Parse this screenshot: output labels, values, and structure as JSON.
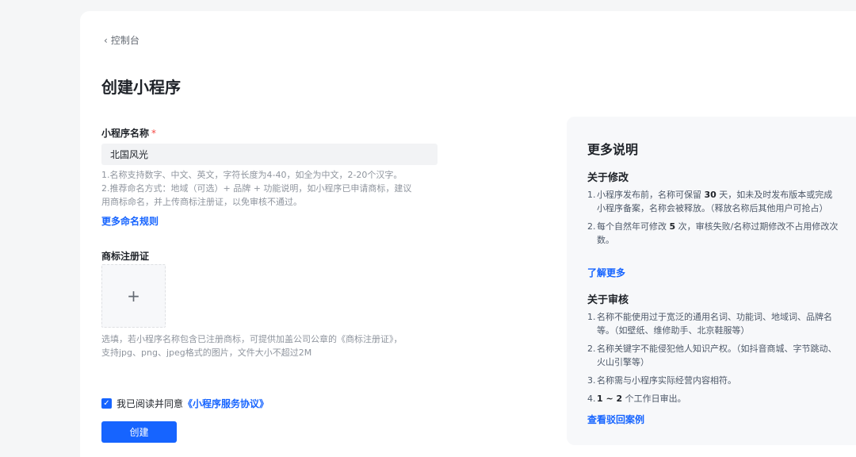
{
  "nav": {
    "back_label": "控制台"
  },
  "page": {
    "title": "创建小程序"
  },
  "form": {
    "name_label": "小程序名称",
    "required_mark": "*",
    "name_value": "北国风光",
    "name_hint_1": "1.名称支持数字、中文、英文，字符长度为4-40，如全为中文，2-20个汉字。",
    "name_hint_2a": "2.推荐命名方式：地域（可选）+ 品牌 + 功能说明，如小程序已申请商标，建议",
    "name_hint_2b": "用商标命名，并上传商标注册证，以免审核不通过。",
    "more_rules_link": "更多命名规则",
    "trademark_label": "商标注册证",
    "upload_plus": "+",
    "trademark_hint_1": "选填，若小程序名称包含已注册商标，可提供加盖公司公章的《商标注册证》，",
    "trademark_hint_2": "支持jpg、png、jpeg格式的图片，文件大小不超过2M",
    "agree_text": "我已阅读并同意",
    "agree_link": "《小程序服务协议》",
    "agree_checked": true,
    "create_button": "创建"
  },
  "sidebar": {
    "title": "更多说明",
    "modify": {
      "title": "关于修改",
      "items": [
        {
          "num": "1.",
          "pre": "小程序发布前，名称可保留 ",
          "bold": "30",
          "post": " 天，如未及时发布版本或完成小程序备案，名称会被释放。（释放名称后其他用户可抢占）"
        },
        {
          "num": "2.",
          "pre": "每个自然年可修改 ",
          "bold": "5",
          "post": " 次，审核失败/名称过期修改不占用修改次数。"
        }
      ],
      "link": "了解更多"
    },
    "review": {
      "title": "关于审核",
      "items": [
        {
          "num": "1.",
          "text": "名称不能使用过于宽泛的通用名词、功能词、地域词、品牌名等。（如壁纸、维修助手、北京鞋服等）"
        },
        {
          "num": "2.",
          "text": "名称关键字不能侵犯他人知识产权。（如抖音商城、字节跳动、火山引擎等）"
        },
        {
          "num": "3.",
          "text": "名称需与小程序实际经营内容相符。"
        },
        {
          "num": "4.",
          "bold": "1 ~ 2",
          "post": " 个工作日审出。"
        }
      ],
      "link": "查看驳回案例"
    }
  },
  "colors": {
    "accent": "#1664ff",
    "required": "#f54a45",
    "text": "#1f2329",
    "hint": "#8f959e"
  }
}
